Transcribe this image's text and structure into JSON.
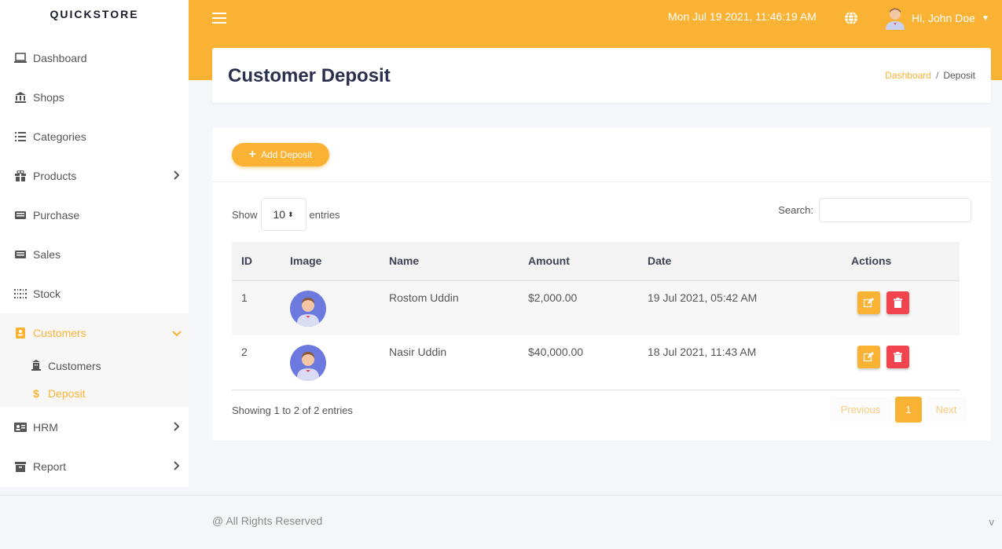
{
  "brand": "QUICKSTORE",
  "sidebar": {
    "items": [
      {
        "label": "Dashboard"
      },
      {
        "label": "Shops"
      },
      {
        "label": "Categories"
      },
      {
        "label": "Products"
      },
      {
        "label": "Purchase"
      },
      {
        "label": "Sales"
      },
      {
        "label": "Stock"
      },
      {
        "label": "Customers"
      },
      {
        "label": "HRM"
      },
      {
        "label": "Report"
      }
    ],
    "sub_items": [
      {
        "label": "Customers"
      },
      {
        "label": "Deposit"
      }
    ]
  },
  "topbar": {
    "datetime": "Mon Jul 19 2021, 11:46:19 AM",
    "user_greeting": "Hi, John Doe"
  },
  "page": {
    "title": "Customer Deposit",
    "breadcrumb": {
      "link": "Dashboard",
      "separator": "/",
      "current": "Deposit"
    }
  },
  "toolbar": {
    "add_label": "Add Deposit"
  },
  "table_controls": {
    "show_label": "Show",
    "entries_value": "10",
    "entries_label": "entries",
    "search_label": "Search:",
    "search_placeholder": ""
  },
  "table": {
    "headers": {
      "id": "ID",
      "image": "Image",
      "name": "Name",
      "amount": "Amount",
      "date": "Date",
      "actions": "Actions"
    },
    "rows": [
      {
        "id": "1",
        "name": "Rostom Uddin",
        "amount": "$2,000.00",
        "date": "19 Jul 2021, 05:42 AM"
      },
      {
        "id": "2",
        "name": "Nasir Uddin",
        "amount": "$40,000.00",
        "date": "18 Jul 2021, 11:43 AM"
      }
    ]
  },
  "pagination": {
    "info": "Showing 1 to 2 of 2 entries",
    "previous": "Previous",
    "current": "1",
    "next": "Next"
  },
  "footer": {
    "text": "@ All Rights Reserved",
    "right": "v"
  },
  "colors": {
    "accent": "#f9b233",
    "danger": "#f1444f",
    "title": "#2b2f4e"
  }
}
